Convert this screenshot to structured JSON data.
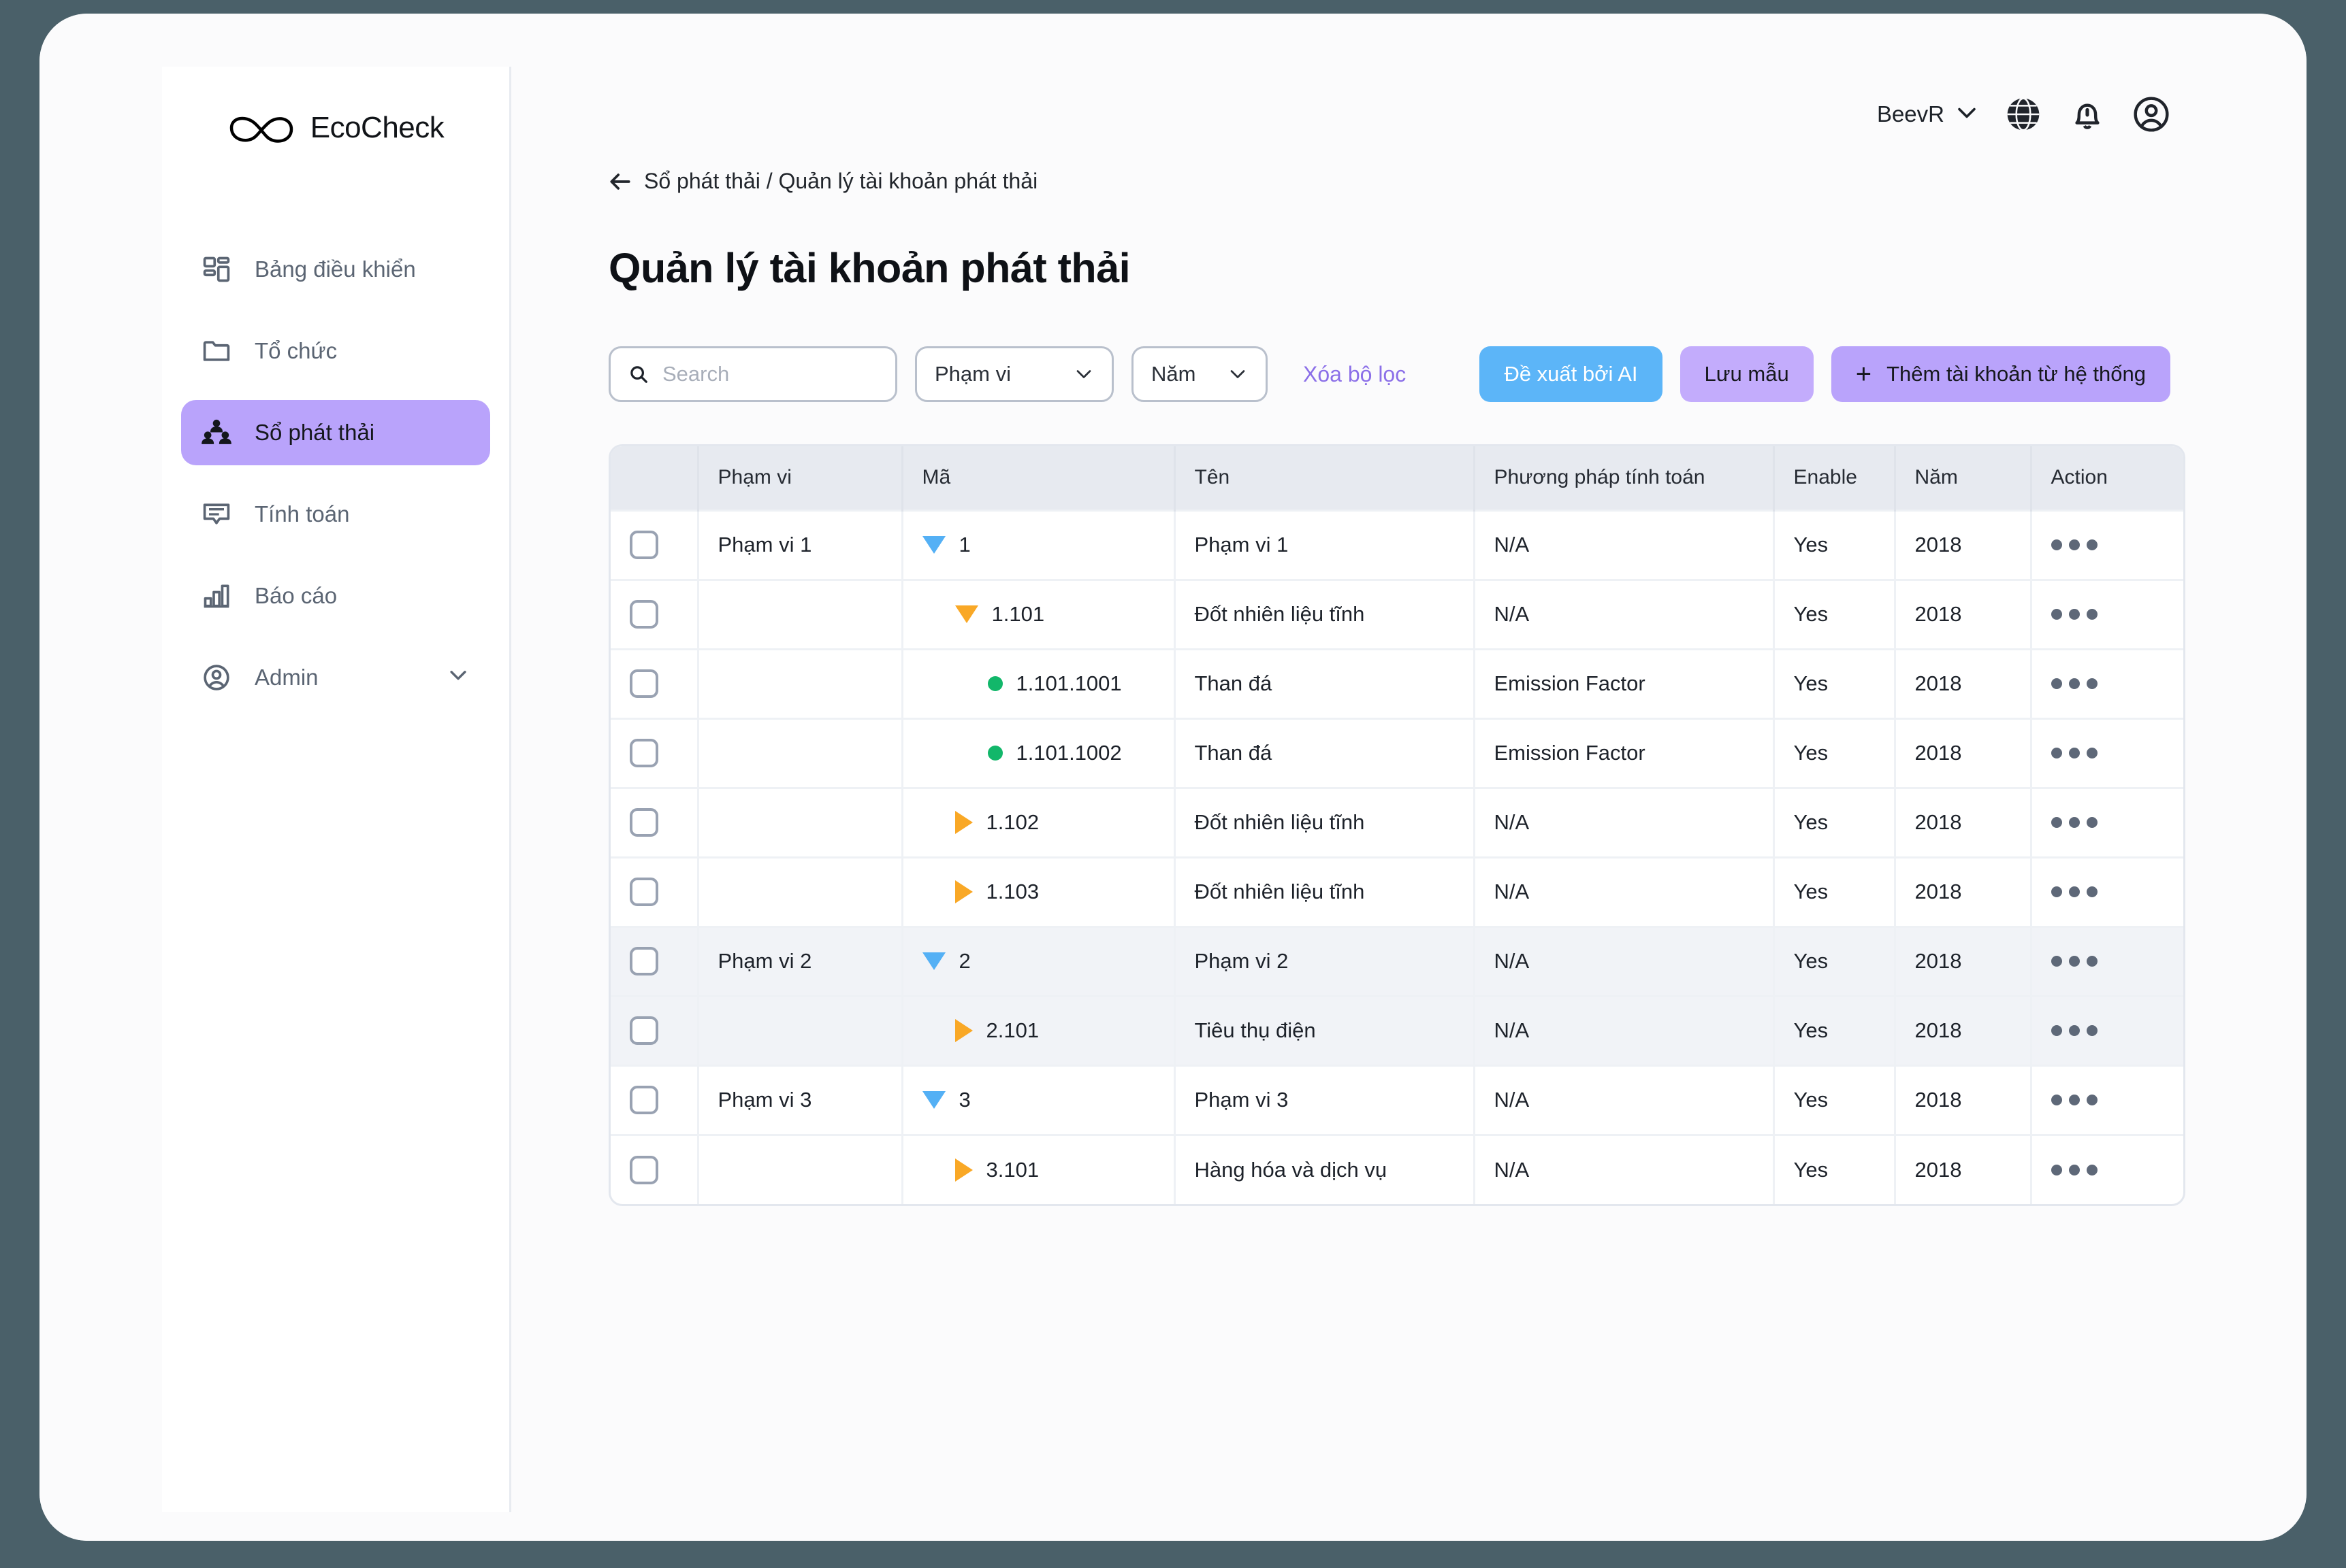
{
  "brand": {
    "name": "EcoCheck",
    "logo_icon": "leaf-infinity-icon"
  },
  "sidebar": {
    "items": [
      {
        "label": "Bảng điều khiển",
        "icon": "dashboard-icon",
        "active": false
      },
      {
        "label": "Tổ chức",
        "icon": "folder-icon",
        "active": false
      },
      {
        "label": "Sổ phát thải",
        "icon": "people-group-icon",
        "active": true
      },
      {
        "label": "Tính toán",
        "icon": "message-lines-icon",
        "active": false
      },
      {
        "label": "Báo cáo",
        "icon": "bar-chart-icon",
        "active": false
      },
      {
        "label": "Admin",
        "icon": "user-circle-icon",
        "active": false,
        "chevron": "chevron-down-icon"
      }
    ]
  },
  "topbar": {
    "user_name": "BeevR",
    "user_chevron_icon": "chevron-down-icon",
    "globe_icon": "globe-icon",
    "bell_icon": "bell-icon",
    "account_icon": "user-circle-icon"
  },
  "breadcrumb": {
    "back_icon": "arrow-left-icon",
    "text": "Sổ phát thải / Quản lý tài khoản phát thải"
  },
  "page_title": "Quản lý tài khoản phát thải",
  "toolbar": {
    "search": {
      "placeholder": "Search",
      "value": "",
      "icon": "search-icon"
    },
    "scope_select": {
      "label": "Phạm vi",
      "chevron_icon": "chevron-down-icon"
    },
    "year_select": {
      "label": "Năm",
      "chevron_icon": "chevron-down-icon"
    },
    "clear_filter_label": "Xóa bộ lọc",
    "ai_button_label": "Đề xuất bởi AI",
    "save_template_button_label": "Lưu mẫu",
    "add_button_label": "Thêm tài khoản từ hệ thống",
    "add_button_plus": "+"
  },
  "table": {
    "columns": [
      "",
      "Phạm vi",
      "Mã",
      "Tên",
      "Phương pháp tính toán",
      "Enable",
      "Năm",
      "Action"
    ],
    "rows": [
      {
        "scope": "Phạm vi 1",
        "code": "1",
        "marker": "triangle-down-blue",
        "indent": 0,
        "name": "Phạm vi 1",
        "method": "N/A",
        "enable": "Yes",
        "year": "2018",
        "highlight": false
      },
      {
        "scope": "",
        "code": "1.101",
        "marker": "triangle-down-orange",
        "indent": 1,
        "name": "Đốt nhiên liệu tĩnh",
        "method": "N/A",
        "enable": "Yes",
        "year": "2018",
        "highlight": false
      },
      {
        "scope": "",
        "code": "1.101.1001",
        "marker": "dot-green",
        "indent": 2,
        "name": "Than đá",
        "method": "Emission Factor",
        "enable": "Yes",
        "year": "2018",
        "highlight": false
      },
      {
        "scope": "",
        "code": "1.101.1002",
        "marker": "dot-green",
        "indent": 2,
        "name": "Than đá",
        "method": "Emission Factor",
        "enable": "Yes",
        "year": "2018",
        "highlight": false
      },
      {
        "scope": "",
        "code": "1.102",
        "marker": "triangle-right-orange",
        "indent": 1,
        "name": "Đốt nhiên liệu tĩnh",
        "method": "N/A",
        "enable": "Yes",
        "year": "2018",
        "highlight": false
      },
      {
        "scope": "",
        "code": "1.103",
        "marker": "triangle-right-orange",
        "indent": 1,
        "name": "Đốt nhiên liệu tĩnh",
        "method": "N/A",
        "enable": "Yes",
        "year": "2018",
        "highlight": false
      },
      {
        "scope": "Phạm vi 2",
        "code": "2",
        "marker": "triangle-down-blue",
        "indent": 0,
        "name": "Phạm vi 2",
        "method": "N/A",
        "enable": "Yes",
        "year": "2018",
        "highlight": true
      },
      {
        "scope": "",
        "code": "2.101",
        "marker": "triangle-right-orange",
        "indent": 1,
        "name": "Tiêu thụ điện",
        "method": "N/A",
        "enable": "Yes",
        "year": "2018",
        "highlight": true
      },
      {
        "scope": "Phạm vi 3",
        "code": "3",
        "marker": "triangle-down-blue",
        "indent": 0,
        "name": "Phạm vi 3",
        "method": "N/A",
        "enable": "Yes",
        "year": "2018",
        "highlight": false
      },
      {
        "scope": "",
        "code": "3.101",
        "marker": "triangle-right-orange",
        "indent": 1,
        "name": "Hàng hóa và dịch vụ",
        "method": "N/A",
        "enable": "Yes",
        "year": "2018",
        "highlight": false
      }
    ]
  },
  "colors": {
    "accent_purple": "#b9a3fb",
    "accent_blue": "#5cb5f8",
    "link_purple": "#8b6fe8",
    "marker_blue": "#54b0f5",
    "marker_orange": "#f9a826",
    "marker_green": "#12b76a",
    "page_backdrop": "#4a6069"
  }
}
